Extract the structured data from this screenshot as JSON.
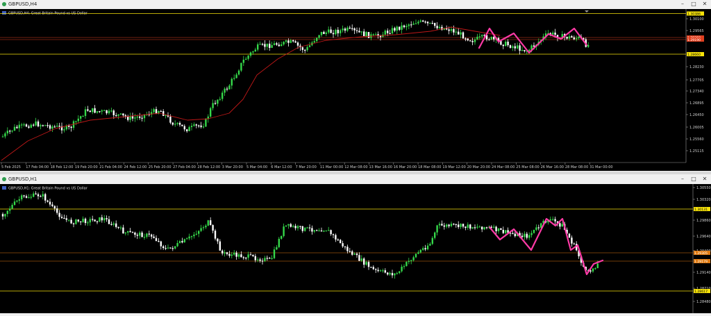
{
  "window1": {
    "title": "GBPUSD,H4",
    "header": "GBPUSD,H4:  Great Britain Pound vs US Dollar",
    "price_ticks": [
      "1.30100",
      "1.29565",
      "1.28230",
      "1.27705",
      "1.27340",
      "1.26895",
      "1.26450",
      "1.26005",
      "1.25560",
      "1.25115"
    ],
    "price_labels": [
      {
        "text": "1.30386",
        "bg": "#f6e20a",
        "fg": "#000000"
      },
      {
        "text": "1.29260",
        "bg": "#e04020",
        "fg": "#ffffff"
      },
      {
        "text": "1.29190",
        "bg": "#e04020",
        "fg": "#ffffff"
      },
      {
        "text": "1.28660",
        "bg": "#f6e20a",
        "fg": "#000000"
      }
    ],
    "time_labels": [
      "5 Feb 2025",
      "17 Feb 04:00",
      "18 Feb 12:00",
      "19 Feb 20:00",
      "21 Feb 04:00",
      "24 Feb 12:00",
      "25 Feb 20:00",
      "27 Feb 04:00",
      "28 Feb 12:00",
      "3 Mar 20:00",
      "5 Mar 04:00",
      "6 Mar 12:00",
      "7 Mar 20:00",
      "11 Mar 00:00",
      "12 Mar 08:00",
      "13 Mar 16:00",
      "16 Mar 20:00",
      "18 Mar 08:00",
      "19 Mar 12:00",
      "20 Mar 20:00",
      "24 Mar 08:00",
      "25 Mar 08:00",
      "26 Mar 16:00",
      "28 Mar 08:00",
      "31 Mar 00:00"
    ]
  },
  "window2": {
    "title": "GBPUSD,H1",
    "header": "GBPUSD,H1:  Great Britain Pound vs US Dollar",
    "price_ticks": [
      "1.30550",
      "1.30320",
      "1.29860",
      "1.29640",
      "1.29400",
      "1.29140",
      "1.28710",
      "1.28480"
    ],
    "price_labels": [
      {
        "text": "1.30131",
        "bg": "#f6e20a",
        "fg": "#000000"
      },
      {
        "text": "1.29305",
        "bg": "#e07a10",
        "fg": "#ffffff"
      },
      {
        "text": "1.29179",
        "bg": "#e07a10",
        "fg": "#ffffff"
      },
      {
        "text": "1.28617",
        "bg": "#f6e20a",
        "fg": "#000000"
      }
    ]
  },
  "colors": {
    "bull": "#35d84a",
    "bear": "#ffffff",
    "zigzag": "#ff3aa6",
    "ma": "#c01818",
    "level_yellow": "#f6e20a",
    "level_red": "#e04020",
    "level_orange": "#e07a10",
    "axis_text": "#cfcfcf",
    "title_green_icon": "#2e9d4e"
  },
  "window_buttons": {
    "minimize": "–",
    "maximize": "□",
    "close": "✕"
  }
}
